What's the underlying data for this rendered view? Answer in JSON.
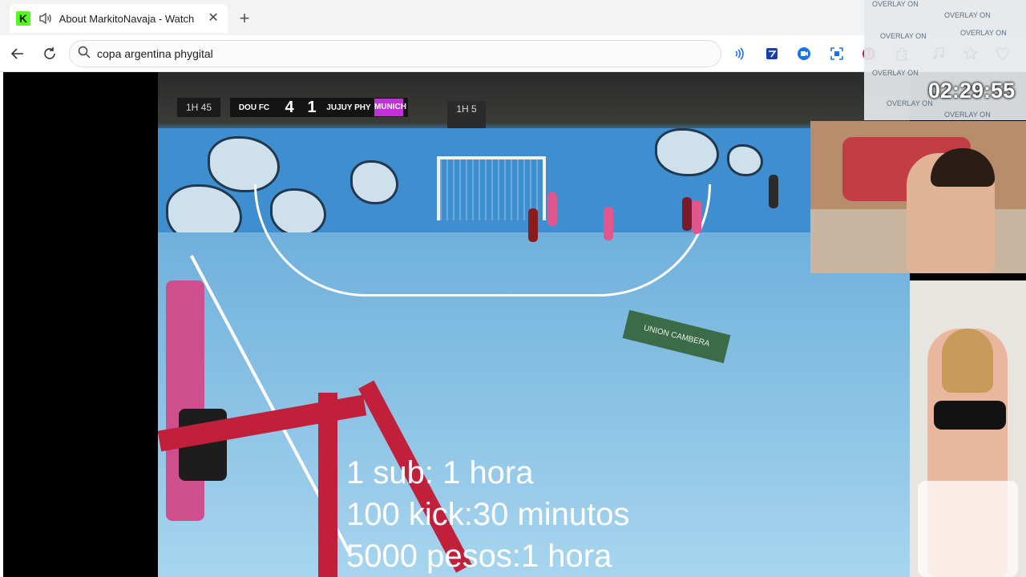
{
  "browser": {
    "tab": {
      "title": "About MarkitoNavaja - Watch",
      "favicon_letter": "K",
      "favicon_color": "#53fc18",
      "audio_icon": "speaker-icon",
      "close_label": "✕"
    },
    "new_tab_label": "+",
    "address_bar": {
      "value": "copa argentina phygital",
      "icon": "search-icon"
    }
  },
  "stream": {
    "scoreboard": {
      "clock_left": "1H 45",
      "home_team": "DOU FC",
      "home_score": "4",
      "away_score": "1",
      "away_team": "JUJUY PHY",
      "brand": "MUNICH",
      "clock_right": "1H 5"
    },
    "floor_logo": "UNION CAMBERA",
    "subs_text": [
      "1 sub: 1 hora",
      "100 kick:30 minutos",
      "5000 pesos:1 hora"
    ],
    "overlay_clock": "02:29:55",
    "overlay_tag": "OVERLAY ON"
  }
}
